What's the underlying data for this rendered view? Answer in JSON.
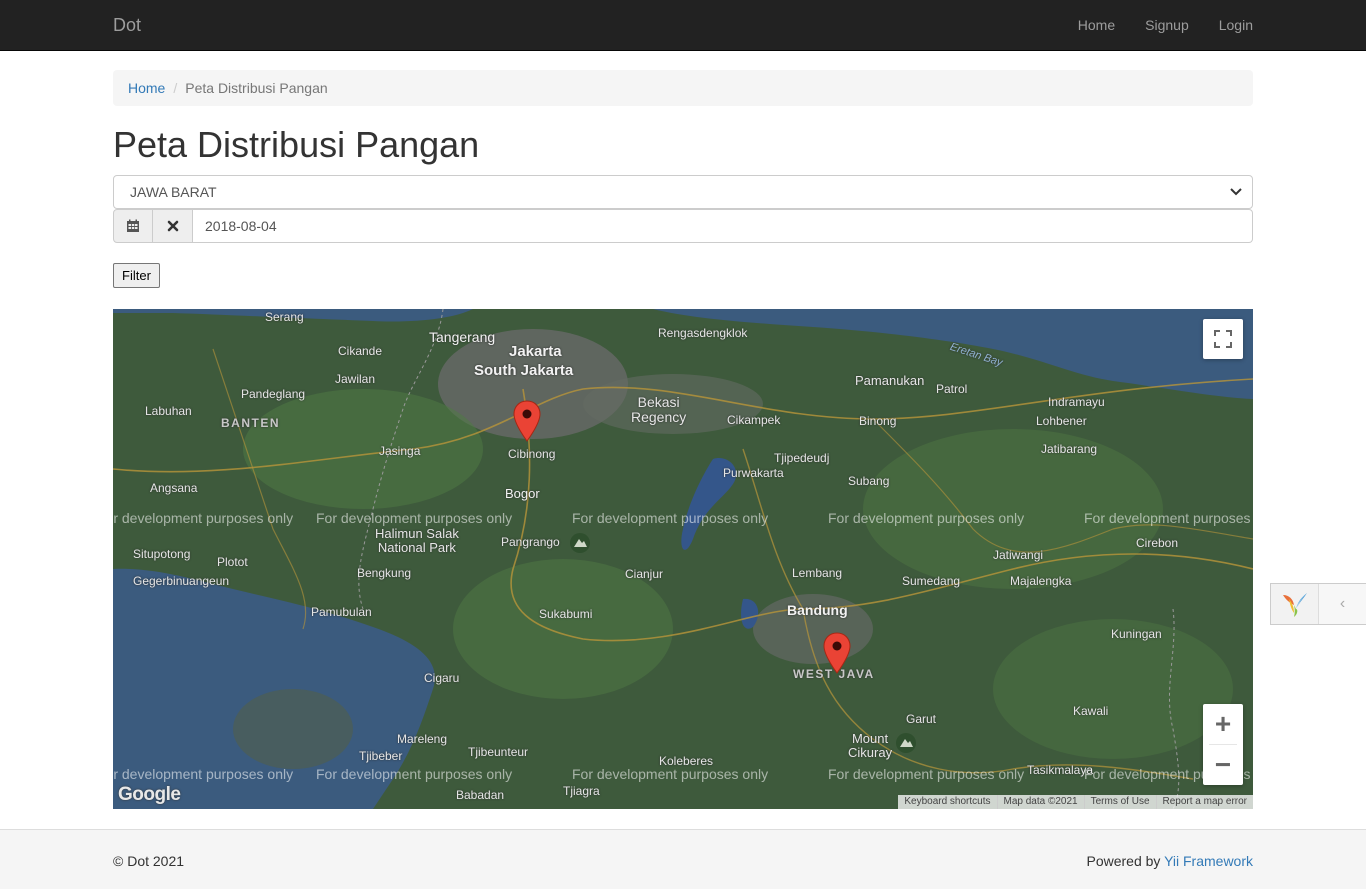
{
  "navbar": {
    "brand": "Dot",
    "links": [
      "Home",
      "Signup",
      "Login"
    ]
  },
  "breadcrumb": {
    "home": "Home",
    "separator": "/",
    "current": "Peta Distribusi Pangan"
  },
  "page": {
    "title": "Peta Distribusi Pangan"
  },
  "filter": {
    "province_selected": "JAWA BARAT",
    "date_value": "2018-08-04",
    "calendar_icon": "calendar-icon",
    "clear_icon": "clear-icon",
    "button_label": "Filter"
  },
  "map": {
    "labels": {
      "serang": "Serang",
      "tangerang": "Tangerang",
      "jakarta": "Jakarta",
      "south_jakarta": "South Jakarta",
      "rengasdengklok": "Rengasdengklok",
      "cikande": "Cikande",
      "jawilan": "Jawilan",
      "pandeglang": "Pandeglang",
      "labuhan": "Labuhan",
      "banten": "BANTEN",
      "bekasi": "Bekasi\nRegency",
      "cikampek": "Cikampek",
      "pamanukan": "Pamanukan",
      "patrol": "Patrol",
      "indramayu": "Indramayu",
      "lohbener": "Lohbener",
      "binong": "Binong",
      "jatibarang": "Jatibarang",
      "eretan_bay": "Eretan Bay",
      "jasinga": "Jasinga",
      "cibinong": "Cibinong",
      "purwakarta": "Purwakarta",
      "tjipedeudj": "Tjipedeudj",
      "subang": "Subang",
      "angsana": "Angsana",
      "bogor": "Bogor",
      "halimun": "Halimun Salak\nNational Park",
      "pangrango": "Pangrango",
      "situpotong": "Situpotong",
      "plotot": "Plotot",
      "bengkung": "Bengkung",
      "cianjur": "Cianjur",
      "lembang": "Lembang",
      "sumedang": "Sumedang",
      "jatiwangi": "Jatiwangi",
      "majalengka": "Majalengka",
      "cirebon": "Cirebon",
      "genteng": "Gegerbinuangeun",
      "pamubulan": "Pamubulan",
      "sukabumi": "Sukabumi",
      "bandung": "Bandung",
      "kuningan": "Kuningan",
      "west_java": "WEST JAVA",
      "cigaru": "Cigaru",
      "kawali": "Kawali",
      "garut": "Garut",
      "mareleng": "Mareleng",
      "tjibeber": "Tjibeber",
      "tjibeunteur": "Tjibeunteur",
      "koleberes": "Koleberes",
      "mount_cikuray": "Mount\nCikuray",
      "tasikmalaya": "Tasikmalaya",
      "babadan": "Babadan",
      "tjiagra": "Tjiagra"
    },
    "dev_watermark": "For development purposes only",
    "fullscreen_icon": "fullscreen-icon",
    "zoom_in": "+",
    "zoom_out": "−",
    "google_logo": "Google",
    "attribution": [
      "Keyboard shortcuts",
      "Map data ©2021",
      "Terms of Use",
      "Report a map error"
    ],
    "marker_color": "#ea4335"
  },
  "debug_toolbar": {
    "logo": "yii-logo",
    "toggle_icon": "chevron-left-icon"
  },
  "footer": {
    "copyright": "© Dot 2021",
    "powered_prefix": "Powered by ",
    "powered_link": "Yii Framework"
  },
  "colors": {
    "navbar_bg": "#222222",
    "link": "#337ab7",
    "land": "#3e5a3c",
    "sea": "#3b5b7e"
  }
}
